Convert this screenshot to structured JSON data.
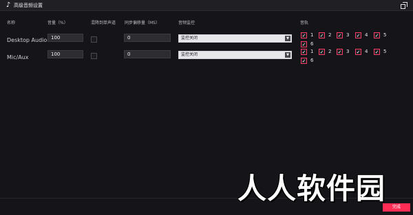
{
  "window": {
    "title": "高级音频设置",
    "icon": "tiktok-logo-icon",
    "restore_icon": "restore-window-icon"
  },
  "headers": {
    "name": "名称",
    "volume": "音量（%）",
    "downmix": "混降到单声道",
    "sync_offset": "同步偏移量（MS）",
    "monitoring": "音频监控",
    "tracks": "音轨"
  },
  "rows": [
    {
      "name": "Desktop Audio",
      "volume": "100",
      "sync_offset": "0",
      "monitoring": "监控关闭",
      "downmix": false,
      "tracks": [
        "1",
        "2",
        "3",
        "4",
        "5",
        "6"
      ],
      "tracks_checked": [
        true,
        true,
        true,
        true,
        true,
        true
      ]
    },
    {
      "name": "Mic/Aux",
      "volume": "100",
      "sync_offset": "0",
      "monitoring": "监控关闭",
      "downmix": false,
      "tracks": [
        "1",
        "2",
        "3",
        "4",
        "5",
        "6"
      ],
      "tracks_checked": [
        true,
        true,
        true,
        true,
        true,
        true
      ]
    }
  ],
  "footer": {
    "ok_label": "完成",
    "watermark": "人人软件园"
  },
  "colors": {
    "accent": "#ff2d55",
    "background": "#151519",
    "checkbox_border": "#ff3d67"
  }
}
